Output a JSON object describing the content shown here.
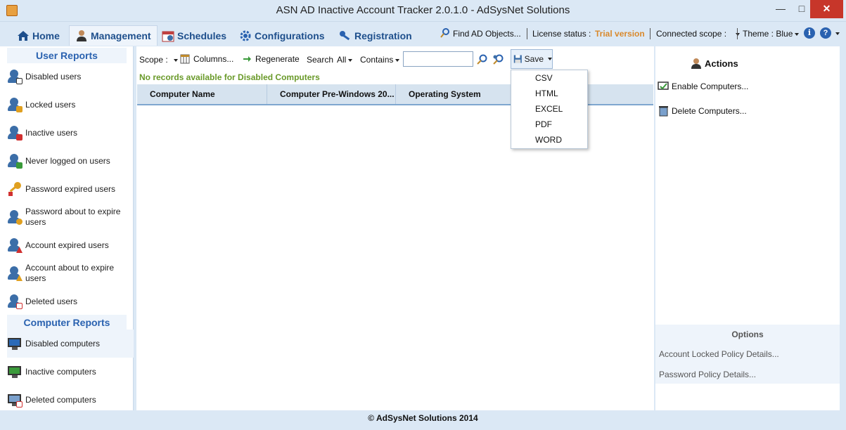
{
  "window": {
    "title": "ASN AD Inactive Account Tracker 2.0.1.0 - AdSysNet Solutions",
    "minimize": "—",
    "maximize": "□",
    "close": "✕"
  },
  "menu": {
    "tabs": [
      {
        "label": "Home",
        "icon": "home-icon"
      },
      {
        "label": "Management",
        "icon": "user-icon"
      },
      {
        "label": "Schedules",
        "icon": "calendar-icon"
      },
      {
        "label": "Configurations",
        "icon": "gear-icon"
      },
      {
        "label": "Registration",
        "icon": "key-icon"
      }
    ],
    "active_tab": "Management",
    "find_ad": "Find AD Objects...",
    "license_label": "License status :",
    "license_value": "Trial version",
    "connected_scope": "Connected scope :",
    "theme": "Theme : Blue",
    "help": "i",
    "question": "?"
  },
  "sidebar": {
    "user_reports_title": "User Reports",
    "user_items": [
      "Disabled users",
      "Locked users",
      "Inactive users",
      "Never logged on users",
      "Password expired users",
      "Password about to expire users",
      "Account expired users",
      "Account about to expire users",
      "Deleted users"
    ],
    "computer_reports_title": "Computer Reports",
    "computer_items": [
      "Disabled computers",
      "Inactive computers",
      "Deleted computers"
    ],
    "selected": "Disabled computers"
  },
  "toolbar": {
    "scope": "Scope :",
    "columns": "Columns...",
    "regenerate": "Regenerate",
    "search": "Search",
    "all": "All",
    "contains": "Contains",
    "search_value": "",
    "save": "Save"
  },
  "save_menu": [
    "CSV",
    "HTML",
    "EXCEL",
    "PDF",
    "WORD"
  ],
  "status_message": "No records available for  Disabled Computers",
  "grid": {
    "columns": [
      "Computer Name",
      "Computer Pre-Windows 20...",
      "Operating System"
    ],
    "rows": []
  },
  "right_panel": {
    "actions_title": "Actions",
    "actions": [
      "Enable Computers...",
      "Delete Computers..."
    ],
    "options_title": "Options",
    "options": [
      "Account Locked Policy Details...",
      "Password Policy Details..."
    ]
  },
  "footer": "© AdSysNet Solutions 2014",
  "colors": {
    "accent": "#1e4f8c",
    "section_title": "#2a62b0",
    "trial": "#d9892c",
    "status_ok": "#6a9a2a"
  }
}
